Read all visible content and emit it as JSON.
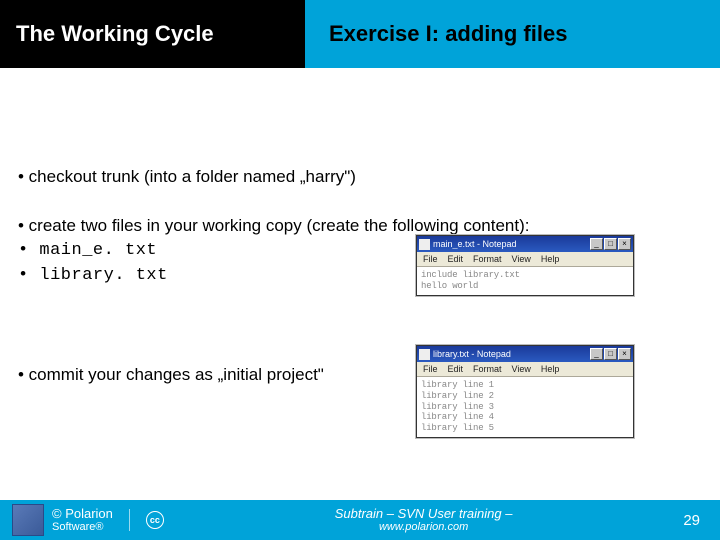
{
  "header": {
    "left_title": "The Working Cycle",
    "right_title": "Exercise I: adding files"
  },
  "bullets": {
    "b1": "• checkout trunk (into a folder named „harry\")",
    "b2": "• create two files in your working copy (create the following content):",
    "b3": "• main_e. txt",
    "b4": "• library. txt",
    "b5": "• commit your changes as „initial project\""
  },
  "notepad1": {
    "title": "main_e.txt - Notepad",
    "menu": [
      "File",
      "Edit",
      "Format",
      "View",
      "Help"
    ],
    "lines": [
      "include library.txt",
      "hello world"
    ]
  },
  "notepad2": {
    "title": "library.txt - Notepad",
    "menu": [
      "File",
      "Edit",
      "Format",
      "View",
      "Help"
    ],
    "lines": [
      "library line 1",
      "library line 2",
      "library line 3",
      "library line 4",
      "library line 5"
    ]
  },
  "footer": {
    "copyright1": "© Polarion",
    "copyright2": "Software®",
    "cc": "cc",
    "center1": "Subtrain – SVN User training –",
    "center2": "www.polarion.com",
    "page": "29"
  },
  "win_controls": {
    "min": "_",
    "max": "□",
    "close": "×"
  }
}
